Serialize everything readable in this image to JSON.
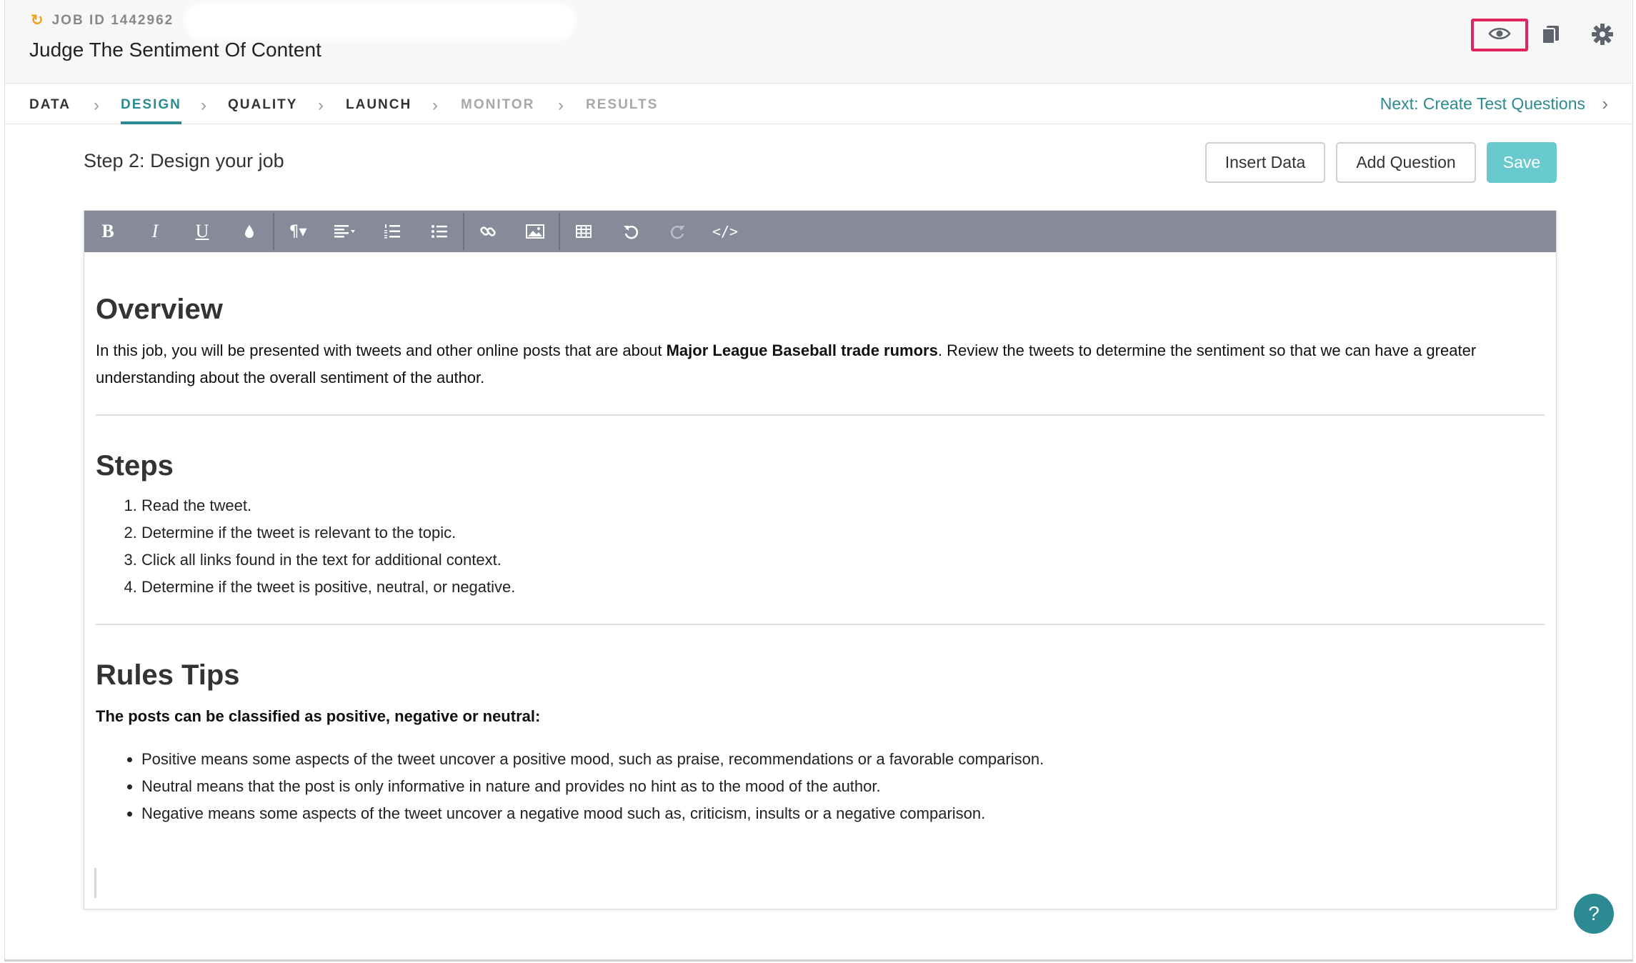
{
  "header": {
    "job_id": "JOB ID 1442962",
    "job_title": "Judge The Sentiment Of Content"
  },
  "nav": {
    "items": [
      {
        "label": "DATA",
        "state": "normal"
      },
      {
        "label": "DESIGN",
        "state": "active"
      },
      {
        "label": "QUALITY",
        "state": "normal"
      },
      {
        "label": "LAUNCH",
        "state": "normal"
      },
      {
        "label": "MONITOR",
        "state": "disabled"
      },
      {
        "label": "RESULTS",
        "state": "disabled"
      }
    ],
    "next_label": "Next: Create Test Questions"
  },
  "toolbar_main": {
    "step_title": "Step 2: Design your job",
    "insert_data": "Insert Data",
    "add_question": "Add Question",
    "save": "Save"
  },
  "editor": {
    "overview": {
      "heading": "Overview",
      "text_before": "In this job, you will be presented with tweets and other online posts that are about ",
      "text_bold": "Major League Baseball trade rumors",
      "text_after": ". Review the tweets to determine the sentiment so that we can have a greater understanding about the overall sentiment of the author."
    },
    "steps": {
      "heading": "Steps",
      "items": [
        "Read the tweet.",
        "Determine if the tweet is relevant to the topic.",
        "Click all links found in the text for additional context.",
        "Determine if the tweet is positive, neutral, or negative."
      ]
    },
    "rules": {
      "heading": "Rules Tips",
      "intro": "The posts can be classified as positive, negative or neutral:",
      "items": [
        "Positive means some aspects of the tweet uncover a positive mood, such as praise, recommendations or a favorable comparison.",
        "Neutral means that the post is only informative in nature and provides no hint as to the mood of the author.",
        "Negative means some aspects of the tweet uncover a negative mood such as, criticism, insults or a negative comparison."
      ]
    }
  },
  "help_label": "?",
  "colors": {
    "accent": "#2c8a93",
    "save_button": "#68c9cf",
    "toolbar_bg": "#878a99",
    "highlight_border": "#e0245e",
    "job_id_icon": "#f0a020"
  }
}
